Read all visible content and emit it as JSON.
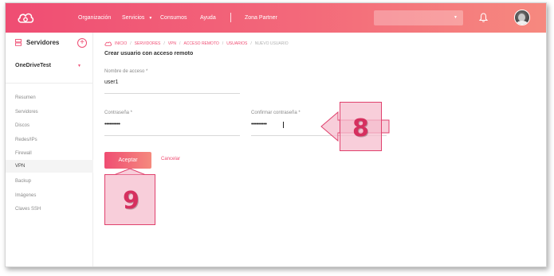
{
  "topbar": {
    "logo_icon": "cloud-logo-icon",
    "nav": [
      {
        "label": "Organización"
      },
      {
        "label": "Servicios",
        "has_dropdown": true
      },
      {
        "label": "Consumos"
      },
      {
        "label": "Ayuda"
      },
      {
        "label": "Zona Partner"
      }
    ],
    "search_value": "",
    "bell_icon": "bell-icon",
    "avatar_icon": "user-avatar"
  },
  "sidebar": {
    "title": "Servidores",
    "account": "OneDriveTest",
    "items": [
      {
        "label": "Resumen"
      },
      {
        "label": "Servidores"
      },
      {
        "label": "Discos"
      },
      {
        "label": "Redes/IPs"
      },
      {
        "label": "Firewall"
      },
      {
        "label": "VPN",
        "active": true
      },
      {
        "label": "Backup"
      },
      {
        "label": "Imágenes"
      },
      {
        "label": "Claves SSH"
      }
    ]
  },
  "breadcrumb": [
    "INICIO",
    "SERVIDORES",
    "VPN",
    "ACCESO REMOTO",
    "USUARIOS",
    "NUEVO USUARIO"
  ],
  "form": {
    "title": "Crear usuario con acceso remoto",
    "username_label": "Nombre de acceso *",
    "username_value": "user1",
    "password_label": "Contraseña *",
    "password_value": "••••••••••",
    "confirm_label": "Confirmar contraseña *",
    "confirm_value": "••••••••••",
    "accept_label": "Aceptar",
    "cancel_label": "Cancelar"
  },
  "callouts": {
    "step_8": "8",
    "step_9": "9"
  },
  "colors": {
    "accent": "#ef4d73",
    "accent_light": "#f6897f",
    "callout_fill": "#f6becd",
    "callout_text": "#d6305f"
  }
}
